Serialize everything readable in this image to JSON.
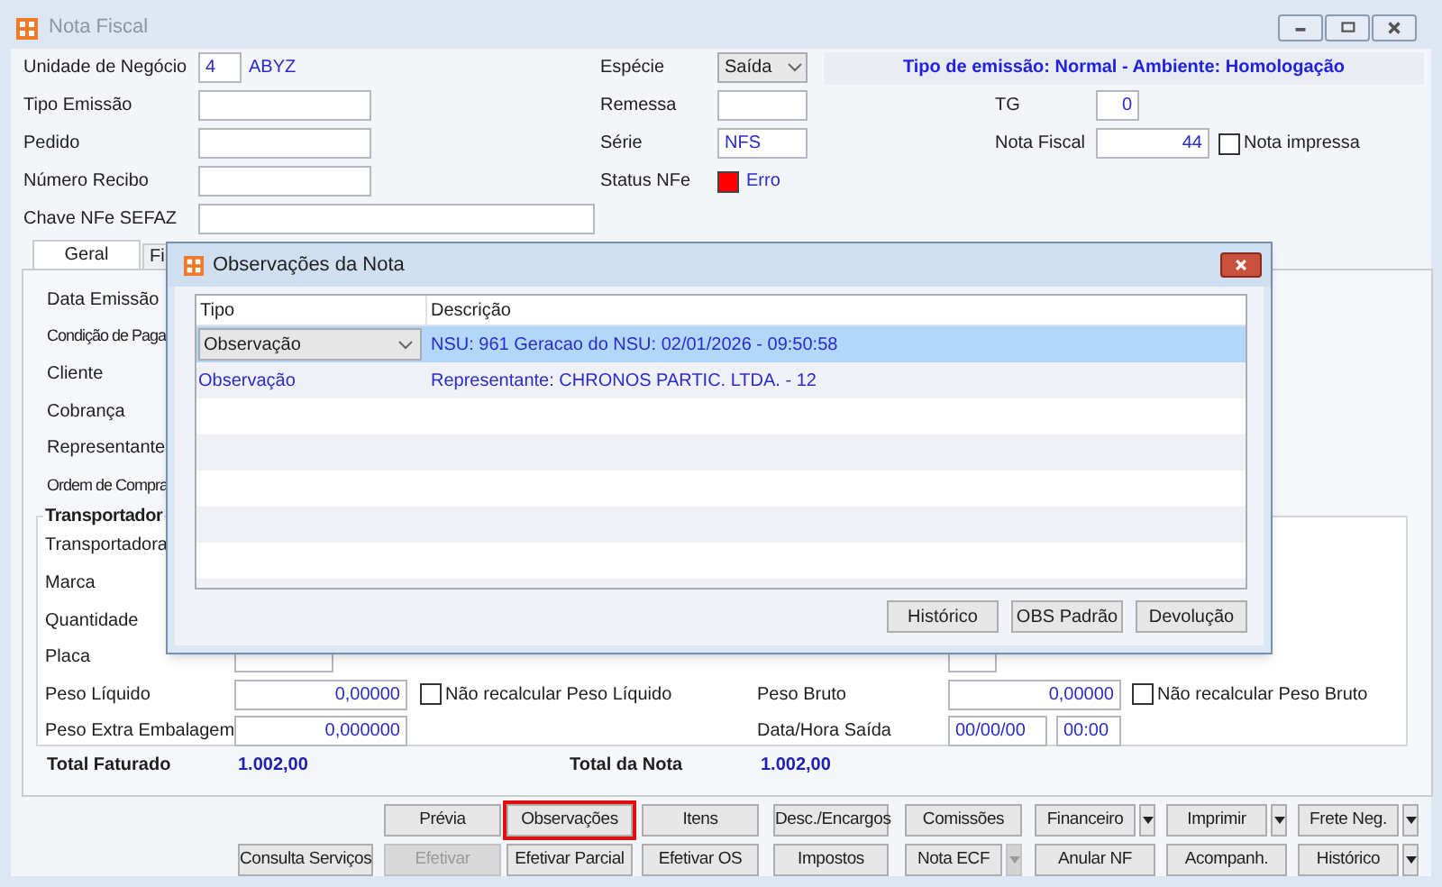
{
  "window": {
    "title": "Nota Fiscal"
  },
  "header_left": [
    {
      "label": "Unidade de Negócio",
      "value": "4",
      "detail": "ABYZ"
    },
    {
      "label": "Tipo Emissão"
    },
    {
      "label": "Pedido"
    },
    {
      "label": "Número Recibo"
    },
    {
      "label": "Chave NFe SEFAZ"
    }
  ],
  "header_middle": [
    {
      "label": "Espécie",
      "kind": "select",
      "value": "Saída"
    },
    {
      "label": "Remessa",
      "kind": "text"
    },
    {
      "label": "Série",
      "kind": "text",
      "value": "NFS"
    },
    {
      "label": "Status NFe",
      "kind": "status",
      "color": "#ff0000",
      "value": "Erro"
    }
  ],
  "banner": "Tipo de emissão: Normal - Ambiente: Homologação",
  "header_right": [
    {
      "label": "TG",
      "value": "0"
    },
    {
      "label": "Nota Fiscal",
      "value": "44",
      "checkbox": {
        "label": "Nota impressa",
        "checked": false
      }
    }
  ],
  "tabs": [
    {
      "label": "Geral",
      "selected": true
    },
    {
      "label": "Fi",
      "selected": false
    }
  ],
  "general_labels": [
    "Data Emissão",
    "Condição de Paga",
    "Cliente",
    "Cobrança",
    "Representante",
    "Ordem de Compra"
  ],
  "transport": {
    "title": "Transportador",
    "labels": [
      "Transportadora",
      "Marca",
      "Quantidade",
      "Placa"
    ],
    "weights": [
      {
        "label": "Peso Líquido",
        "value": "0,00000",
        "checkbox": {
          "label": "Não recalcular Peso Líquido",
          "checked": false
        },
        "right_label": "Peso Bruto",
        "right_value": "0,00000",
        "right_checkbox": {
          "label": "Não recalcular Peso Bruto",
          "checked": false
        }
      },
      {
        "label": "Peso Extra Embalagem",
        "value": "0,000000",
        "right_label": "Data/Hora Saída",
        "right_values": [
          "00/00/00",
          "00:00"
        ]
      }
    ]
  },
  "totals": [
    {
      "label": "Total Faturado",
      "value": "1.002,00"
    },
    {
      "label": "Total da Nota",
      "value": "1.002,00"
    }
  ],
  "buttons": [
    [
      {
        "label": "Prévia",
        "disabled": false,
        "highlighted": false
      },
      {
        "label": "Observações",
        "disabled": false,
        "highlighted": true
      },
      {
        "label": "Itens",
        "disabled": false,
        "highlighted": false
      },
      {
        "label": "Desc./Encargos",
        "disabled": false,
        "highlighted": false
      },
      {
        "label": "Comissões",
        "disabled": false,
        "highlighted": false
      },
      {
        "label": "Financeiro",
        "disabled": false,
        "highlighted": false,
        "dropdown": true,
        "dropdown_disabled": false
      },
      {
        "label": "Imprimir",
        "disabled": false,
        "highlighted": false,
        "dropdown": true,
        "dropdown_disabled": false
      },
      {
        "label": "Frete Neg.",
        "disabled": false,
        "highlighted": false,
        "dropdown": true,
        "dropdown_disabled": false
      }
    ],
    [
      {
        "label": "Consulta Serviços",
        "disabled": false,
        "highlighted": false
      },
      {
        "label": "Efetivar",
        "disabled": true,
        "highlighted": false
      },
      {
        "label": "Efetivar Parcial",
        "disabled": false,
        "highlighted": false
      },
      {
        "label": "Efetivar OS",
        "disabled": false,
        "highlighted": false
      },
      {
        "label": "Impostos",
        "disabled": false,
        "highlighted": false
      },
      {
        "label": "Nota ECF",
        "disabled": false,
        "highlighted": false,
        "dropdown": true,
        "dropdown_disabled": true
      },
      {
        "label": "Anular NF",
        "disabled": false,
        "highlighted": false
      },
      {
        "label": "Acompanh.",
        "disabled": false,
        "highlighted": false
      },
      {
        "label": "Histórico",
        "disabled": false,
        "highlighted": false,
        "dropdown": true,
        "dropdown_disabled": false
      }
    ]
  ],
  "dialog": {
    "title": "Observações da Nota",
    "columns": [
      "Tipo",
      "Descrição"
    ],
    "rows": [
      {
        "tipo": "Observação",
        "descricao": "NSU: 961 Geracao do NSU: 02/01/2026 - 09:50:58",
        "selected": true
      },
      {
        "tipo": "Observação",
        "descricao": "Representante: CHRONOS PARTIC. LTDA. - 12",
        "selected": false
      }
    ],
    "buttons": [
      "Histórico",
      "OBS Padrão",
      "Devolução"
    ]
  }
}
